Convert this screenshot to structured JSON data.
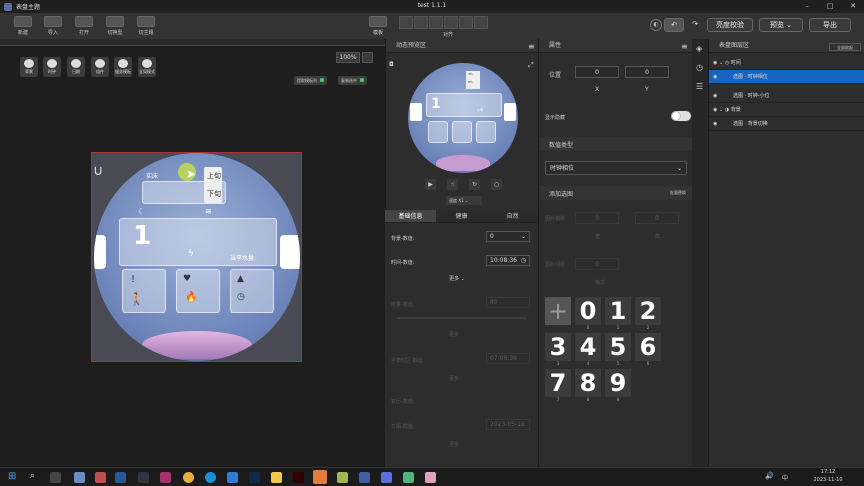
{
  "window": {
    "app_title": "表盘主题",
    "title": "test 1.1.1"
  },
  "toolbar": {
    "new": "新建",
    "import": "导入",
    "open": "打开",
    "switch_type": "切换型",
    "switch_theme": "切主题",
    "template": "模板",
    "align": "对齐",
    "brightness": "亮度校验",
    "preview": "预览",
    "export": "导出"
  },
  "canvas": {
    "quick_buttons": [
      "背景",
      "时钟",
      "日期",
      "组件",
      "服务模板",
      "全局模式"
    ],
    "group_buttons": [
      "提取模板列",
      "复制选中"
    ],
    "zoom": "100%"
  },
  "watch": {
    "label_top": "实床",
    "btn_up": "上旬",
    "btn_down": "下旬",
    "status_text": "当李水量:",
    "mini_labels": [
      "3%",
      "8%",
      "心率"
    ]
  },
  "preview_panel": {
    "title": "动态预览区",
    "speed": "速度 X1"
  },
  "mid_tabs": {
    "items": [
      "基础信息",
      "健康",
      "自然"
    ]
  },
  "mid_rows": {
    "background_label": "背景-数值:",
    "background_value": "0",
    "time_label": "时间-数值:",
    "time_value": "10:08:36",
    "more": "更多",
    "dim_label_1": "电量-数值:",
    "dim_value_1": "80",
    "dim_label_2": "手表时区-数值:",
    "dim_value_2": "07:08:36",
    "dim_label_3": "农历-数值:",
    "dim_label_4": "日期-数值:",
    "dim_value_4": "2023-05-18"
  },
  "props": {
    "title": "属性",
    "position_label": "位置",
    "x_value": "0",
    "y_value": "0",
    "x_axis": "X",
    "y_axis": "Y",
    "show_hidden": "显示隐藏",
    "data_type_label": "数值类型",
    "data_type_value": "时钟相位",
    "add_options": "添加选图",
    "batch_replace": "批量替换",
    "dim_label_a": "图片偏移",
    "dim_val_a1": "0",
    "dim_val_a2": "0",
    "dim_axis_a1": "宽",
    "dim_axis_a2": "高",
    "dim_label_b": "图片间距",
    "dim_val_b": "0",
    "dim_axis_b": "格式"
  },
  "digits": {
    "glyphs": [
      "+",
      "0",
      "1",
      "2",
      "3",
      "4",
      "5",
      "6",
      "7",
      "8",
      "9"
    ],
    "labels": [
      "0",
      "1",
      "2",
      "3",
      "4",
      "5",
      "6",
      "7",
      "8",
      "9"
    ]
  },
  "layers": {
    "title": "表盘图层区",
    "collapse_all": "全部收起",
    "items": [
      "时间",
      "选图 · 时钟相位",
      "选图 · 时钟-小位",
      "背景",
      "选图 · 背景切换"
    ]
  },
  "taskbar": {
    "time": "17:12",
    "date": "2023-11-10",
    "lang": "中"
  },
  "colors": {
    "accent": "#1565c0",
    "toggle": "#e0e0e0",
    "status_dot": "#45d16b"
  }
}
